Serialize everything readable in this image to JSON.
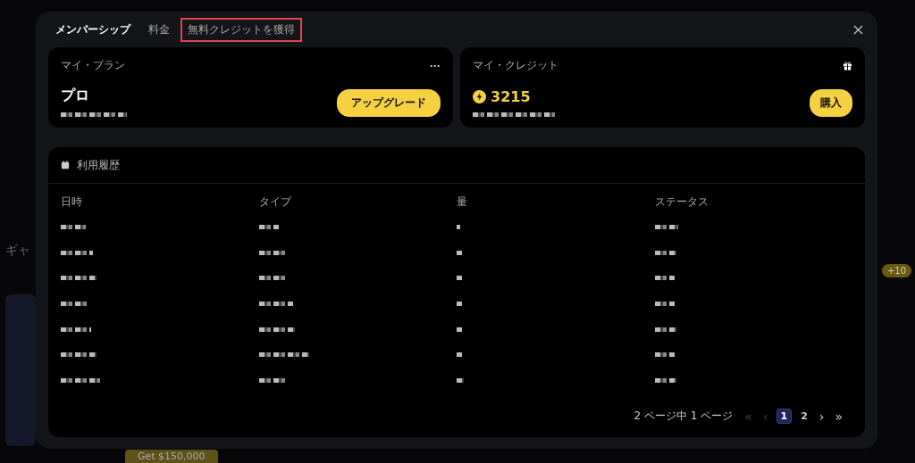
{
  "background": {
    "heading": "ギャ",
    "badge": "+10",
    "banner": "Get $150,000"
  },
  "tabs": [
    {
      "label": "メンバーシップ",
      "selected": true,
      "highlighted": false
    },
    {
      "label": "料金",
      "selected": false,
      "highlighted": false
    },
    {
      "label": "無料クレジットを獲得",
      "selected": false,
      "highlighted": true
    }
  ],
  "plan_card": {
    "title": "マイ・プラン",
    "menu": "···",
    "plan": "プロ",
    "detail_redacted": true,
    "button": "アップグレード"
  },
  "credit_card": {
    "title": "マイ・クレジット",
    "amount": "3215",
    "detail_redacted": true,
    "button": "購入"
  },
  "history": {
    "title": "利用履歴",
    "columns": [
      "日時",
      "タイプ",
      "量",
      "ステータス"
    ],
    "rows": [
      {
        "redacted": true
      },
      {
        "redacted": true
      },
      {
        "redacted": true
      },
      {
        "redacted": true
      },
      {
        "redacted": true
      },
      {
        "redacted": true
      },
      {
        "redacted": true
      }
    ]
  },
  "pagination": {
    "summary": "2 ページ中 1 ページ",
    "controls": [
      {
        "label": "«",
        "kind": "arrow",
        "disabled": true,
        "selected": false
      },
      {
        "label": "‹",
        "kind": "arrow",
        "disabled": true,
        "selected": false
      },
      {
        "label": "1",
        "kind": "page",
        "disabled": false,
        "selected": true
      },
      {
        "label": "2",
        "kind": "page",
        "disabled": false,
        "selected": false
      },
      {
        "label": "›",
        "kind": "arrow",
        "disabled": false,
        "selected": false
      },
      {
        "label": "»",
        "kind": "arrow",
        "disabled": false,
        "selected": false
      }
    ]
  }
}
